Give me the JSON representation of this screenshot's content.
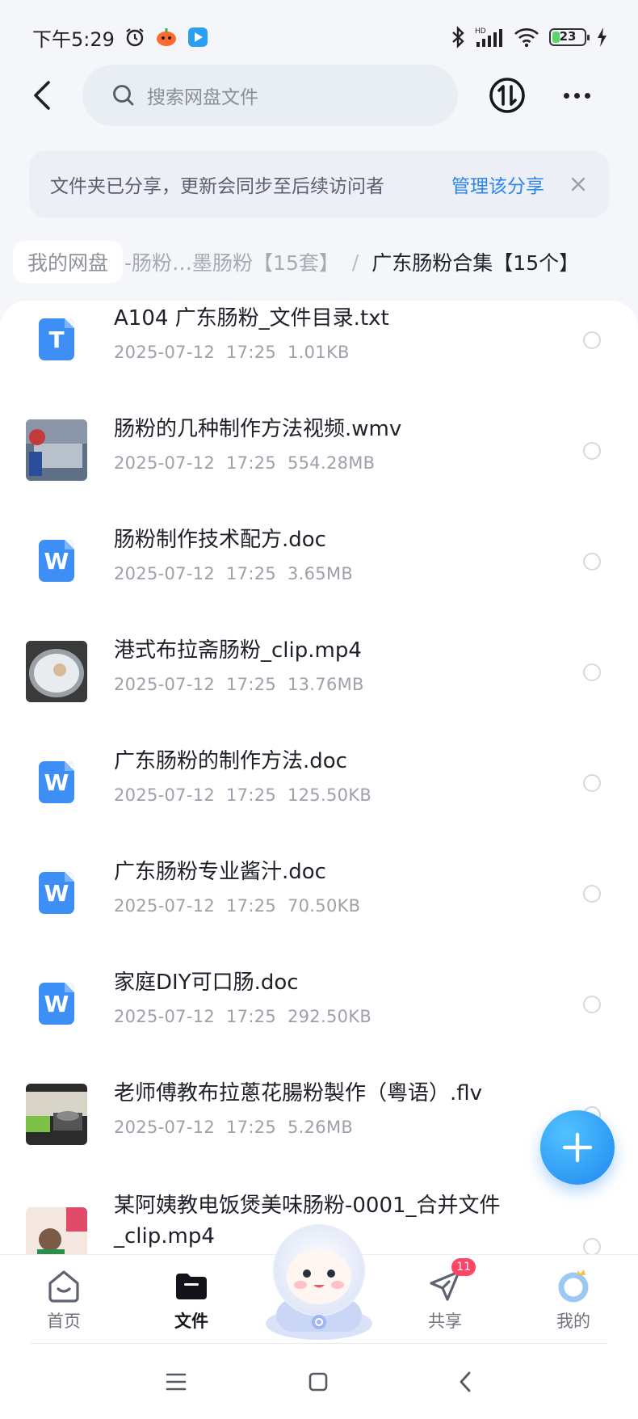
{
  "status_bar": {
    "time": "下午5:29",
    "battery_level": "23",
    "battery_fraction": 0.23,
    "icons": [
      "alarm-icon",
      "app-notification-icon",
      "play-app-icon",
      "bluetooth-icon",
      "hd-signal-icon",
      "wifi-icon",
      "battery-icon",
      "charging-icon"
    ]
  },
  "top_bar": {
    "search_placeholder": "搜索网盘文件",
    "back_icon": "back-arrow-icon",
    "transfer_icon": "transfer-icon",
    "more_icon": "more-icon"
  },
  "banner": {
    "text": "文件夹已分享，更新会同步至后续访问者",
    "action": "管理该分享",
    "close_icon": "close-icon"
  },
  "breadcrumb": {
    "root": "我的网盘",
    "middle": "-肠粉…墨肠粉【15套】",
    "separator": "/",
    "current": "广东肠粉合集【15个】"
  },
  "files": [
    {
      "name": "A104 广东肠粉_文件目录.txt",
      "date": "2025-07-12",
      "time": "17:25",
      "size": "1.01KB",
      "icon": "text-file-icon",
      "letter": "T"
    },
    {
      "name": "肠粉的几种制作方法视频.wmv",
      "date": "2025-07-12",
      "time": "17:25",
      "size": "554.28MB",
      "icon": "video-thumbnail"
    },
    {
      "name": "肠粉制作技术配方.doc",
      "date": "2025-07-12",
      "time": "17:25",
      "size": "3.65MB",
      "icon": "word-doc-icon",
      "letter": "W"
    },
    {
      "name": "港式布拉斋肠粉_clip.mp4",
      "date": "2025-07-12",
      "time": "17:25",
      "size": "13.76MB",
      "icon": "video-thumbnail"
    },
    {
      "name": "广东肠粉的制作方法.doc",
      "date": "2025-07-12",
      "time": "17:25",
      "size": "125.50KB",
      "icon": "word-doc-icon",
      "letter": "W"
    },
    {
      "name": "广东肠粉专业酱汁.doc",
      "date": "2025-07-12",
      "time": "17:25",
      "size": "70.50KB",
      "icon": "word-doc-icon",
      "letter": "W"
    },
    {
      "name": "家庭DIY可口肠.doc",
      "date": "2025-07-12",
      "time": "17:25",
      "size": "292.50KB",
      "icon": "word-doc-icon",
      "letter": "W"
    },
    {
      "name": "老师傅教布拉蔥花腸粉製作（粵语）.flv",
      "date": "2025-07-12",
      "time": "17:25",
      "size": "5.26MB",
      "icon": "video-thumbnail"
    },
    {
      "name": "某阿姨教电饭煲美味肠粉-0001_合并文件_clip.mp4",
      "date": "",
      "time": "",
      "size": "",
      "icon": "video-thumbnail"
    }
  ],
  "fab": {
    "icon": "plus-icon"
  },
  "tabs": [
    {
      "label": "首页",
      "icon": "home-icon",
      "active": false
    },
    {
      "label": "文件",
      "icon": "folder-icon",
      "active": true
    },
    {
      "label": "共享",
      "icon": "share-icon",
      "active": false,
      "badge": "11"
    },
    {
      "label": "我的",
      "icon": "profile-icon",
      "active": false
    }
  ],
  "nav": {
    "icons": [
      "menu-icon",
      "home-square-icon",
      "back-icon"
    ]
  },
  "colors": {
    "accent": "#2f86e8",
    "doc_blue": "#3d8ef5",
    "badge_red": "#ff4565"
  }
}
